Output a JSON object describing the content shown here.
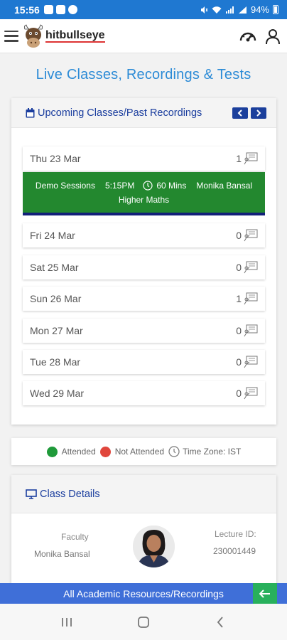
{
  "status_bar": {
    "time": "15:56",
    "battery": "94%"
  },
  "app_bar": {
    "brand": "hitbullseye"
  },
  "page_title": "Live Classes, Recordings & Tests",
  "upcoming": {
    "title": "Upcoming Classes/Past Recordings",
    "days": [
      {
        "label": "Thu 23 Mar",
        "count": "1"
      },
      {
        "label": "Fri 24 Mar",
        "count": "0"
      },
      {
        "label": "Sat 25 Mar",
        "count": "0"
      },
      {
        "label": "Sun 26 Mar",
        "count": "1"
      },
      {
        "label": "Mon 27 Mar",
        "count": "0"
      },
      {
        "label": "Tue 28 Mar",
        "count": "0"
      },
      {
        "label": "Wed 29 Mar",
        "count": "0"
      }
    ],
    "session": {
      "name": "Demo Sessions",
      "time": "5:15PM",
      "duration": "60 Mins",
      "faculty": "Monika Bansal",
      "subject": "Higher Maths",
      "color": "#23882f"
    }
  },
  "legend": {
    "attended": "Attended",
    "not_attended": "Not Attended",
    "timezone": "Time Zone: IST",
    "attended_color": "#1f9a3a",
    "not_attended_color": "#e0463c"
  },
  "class_details": {
    "title": "Class Details",
    "faculty_label": "Faculty",
    "faculty_name": "Monika Bansal",
    "lecture_label": "Lecture ID:",
    "lecture_id": "230001449"
  },
  "bottom_banner": {
    "label": "All Academic Resources/Recordings"
  },
  "colors": {
    "accent": "#2c8bd6",
    "nav_blue": "#1b3f9c",
    "banner": "#3f6fd8",
    "status_bar": "#1f78d1"
  }
}
